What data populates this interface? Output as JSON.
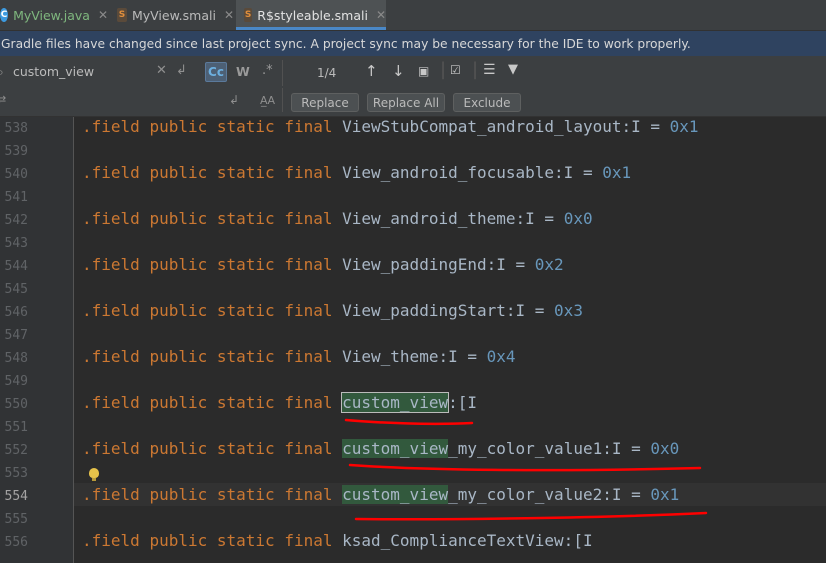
{
  "tabs": [
    {
      "label": "MyView.java",
      "icon": "java-class-icon",
      "glyph": "C"
    },
    {
      "label": "MyView.smali",
      "icon": "smali-file-icon",
      "glyph": "S"
    },
    {
      "label": "R$styleable.smali",
      "icon": "smali-file-icon",
      "glyph": "S",
      "active": true
    }
  ],
  "banner": {
    "text": "Gradle files have changed since last project sync. A project sync may be necessary for the IDE to work properly."
  },
  "search": {
    "query": "custom_view",
    "match_case_label": "Cc",
    "words_label": "W",
    "regex_label": ".*",
    "match_count": "1/4",
    "replace_label": "Replace",
    "replace_all_label": "Replace All",
    "exclude_label": "Exclude"
  },
  "editor": {
    "line_numbers": [
      "538",
      "539",
      "540",
      "541",
      "542",
      "543",
      "544",
      "545",
      "546",
      "547",
      "548",
      "549",
      "550",
      "551",
      "552",
      "553",
      "554",
      "555",
      "556"
    ],
    "current_line": "554",
    "keywords": {
      "field": ".field",
      "public": "public",
      "static": "static",
      "final": "final"
    },
    "lines": {
      "l538": {
        "name": "ViewStubCompat_android_layout:I = ",
        "value": "0x1"
      },
      "l540": {
        "name": "View_android_focusable:I = ",
        "value": "0x1"
      },
      "l542": {
        "name": "View_android_theme:I = ",
        "value": "0x0"
      },
      "l544": {
        "name": "View_paddingEnd:I = ",
        "value": "0x2"
      },
      "l546": {
        "name": "View_paddingStart:I = ",
        "value": "0x3"
      },
      "l548": {
        "name": "View_theme:I = ",
        "value": "0x4"
      },
      "l550": {
        "match": "custom_view",
        "rest": ":[I"
      },
      "l552": {
        "match": "custom_view",
        "rest": "_my_color_value1:I = ",
        "value": "0x0"
      },
      "l554": {
        "match": "custom_view",
        "rest": "_my_color_value2:I = ",
        "value": "0x1"
      },
      "l556": {
        "name": "ksad_ComplianceTextView:[I"
      }
    }
  },
  "colors": {
    "keyword": "#cc7832",
    "number": "#6897bb",
    "text": "#a9b7c6",
    "match_highlight": "#32593d",
    "annotation": "#ff0000",
    "banner": "#2f4360"
  }
}
